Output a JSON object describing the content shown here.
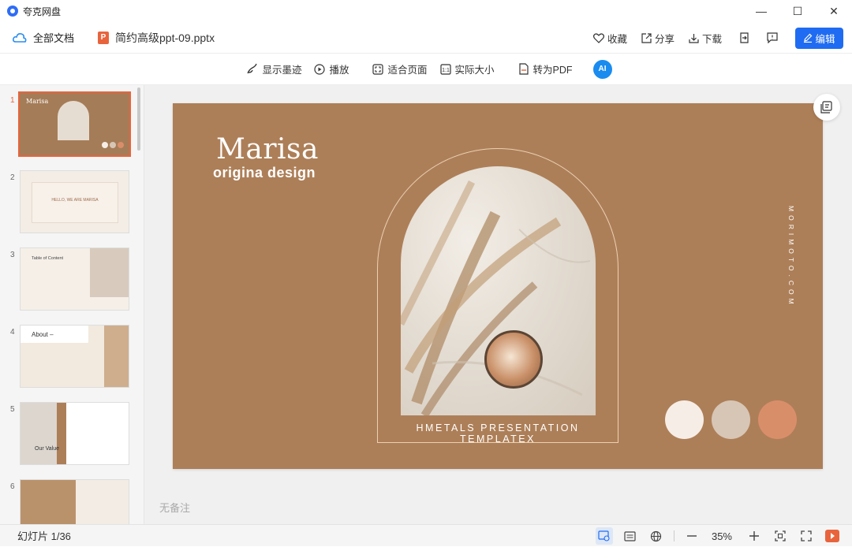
{
  "app": {
    "name": "夸克网盘"
  },
  "window": {
    "minimize": "—",
    "maximize": "☐",
    "close": "✕"
  },
  "docbar": {
    "all_docs": "全部文档",
    "file_name": "简约高级ppt-09.pptx",
    "favorite": "收藏",
    "share": "分享",
    "download": "下载",
    "edit": "编辑"
  },
  "toolbar": {
    "show_ink": "显示墨迹",
    "play": "播放",
    "fit_page": "适合页面",
    "actual_size": "实际大小",
    "to_pdf": "转为PDF",
    "ai": "AI"
  },
  "thumbnails": [
    {
      "num": "1",
      "text": "Marisa"
    },
    {
      "num": "2",
      "text": "HELLO, WE ARE MARISA"
    },
    {
      "num": "3",
      "text": "Table of Content"
    },
    {
      "num": "4",
      "text": "About –"
    },
    {
      "num": "5",
      "text": "Our Value"
    },
    {
      "num": "6",
      "text": ""
    }
  ],
  "slide": {
    "title": "Marisa",
    "subtitle": "origina design",
    "tagline": "HMETALS PRESENTATION TEMPLATEX",
    "vertical_text": "MORIMOTO.COM",
    "swatches": [
      "#f6ede6",
      "#d7c6b6",
      "#d98e6a"
    ],
    "bg_color": "#ad7f58"
  },
  "notes": {
    "placeholder": "无备注"
  },
  "status": {
    "slide_counter": "幻灯片 1/36",
    "zoom": "35%"
  },
  "colors": {
    "accent": "#1f6cf2",
    "ppt": "#e8643c"
  }
}
